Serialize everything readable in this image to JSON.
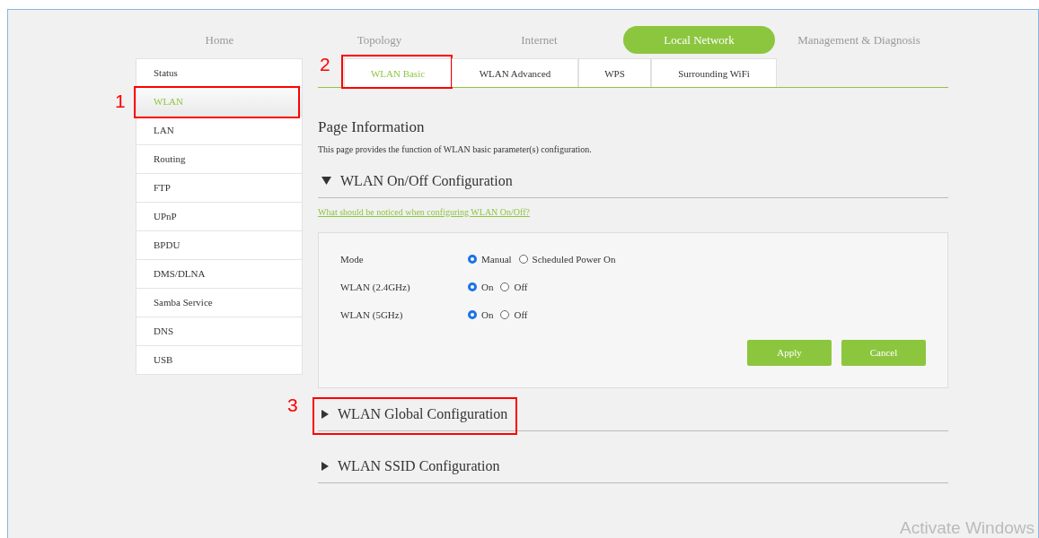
{
  "nav": [
    {
      "label": "Home",
      "selected": false
    },
    {
      "label": "Topology",
      "selected": false
    },
    {
      "label": "Internet",
      "selected": false
    },
    {
      "label": "Local Network",
      "selected": true
    },
    {
      "label": "Management & Diagnosis",
      "selected": false
    }
  ],
  "sidebar": {
    "items": [
      {
        "label": "Status",
        "selected": false
      },
      {
        "label": "WLAN",
        "selected": true,
        "annotation": "1"
      },
      {
        "label": "LAN",
        "selected": false
      },
      {
        "label": "Routing",
        "selected": false
      },
      {
        "label": "FTP",
        "selected": false
      },
      {
        "label": "UPnP",
        "selected": false
      },
      {
        "label": "BPDU",
        "selected": false
      },
      {
        "label": "DMS/DLNA",
        "selected": false
      },
      {
        "label": "Samba Service",
        "selected": false
      },
      {
        "label": "DNS",
        "selected": false
      },
      {
        "label": "USB",
        "selected": false
      }
    ]
  },
  "tabs": [
    {
      "label": "WLAN Basic",
      "selected": true,
      "annotation": "2"
    },
    {
      "label": "WLAN Advanced",
      "selected": false
    },
    {
      "label": "WPS",
      "selected": false
    },
    {
      "label": "Surrounding WiFi",
      "selected": false
    }
  ],
  "page_info": {
    "title": "Page Information",
    "description": "This page provides the function of WLAN basic parameter(s) configuration."
  },
  "sections": [
    {
      "title": "WLAN On/Off Configuration",
      "expanded": true,
      "help_link": "What should be noticed when configuring WLAN On/Off?",
      "fields": [
        {
          "label": "Mode",
          "options": [
            {
              "label": "Manual",
              "selected": true
            },
            {
              "label": "Scheduled Power On",
              "selected": false
            }
          ]
        },
        {
          "label": "WLAN (2.4GHz)",
          "options": [
            {
              "label": "On",
              "selected": true
            },
            {
              "label": "Off",
              "selected": false
            }
          ]
        },
        {
          "label": "WLAN (5GHz)",
          "options": [
            {
              "label": "On",
              "selected": true
            },
            {
              "label": "Off",
              "selected": false
            }
          ]
        }
      ],
      "buttons": [
        "Apply",
        "Cancel"
      ]
    },
    {
      "title": "WLAN Global Configuration",
      "expanded": false,
      "annotation": "3"
    },
    {
      "title": "WLAN SSID Configuration",
      "expanded": false
    }
  ],
  "os_notice": "Activate Windows"
}
